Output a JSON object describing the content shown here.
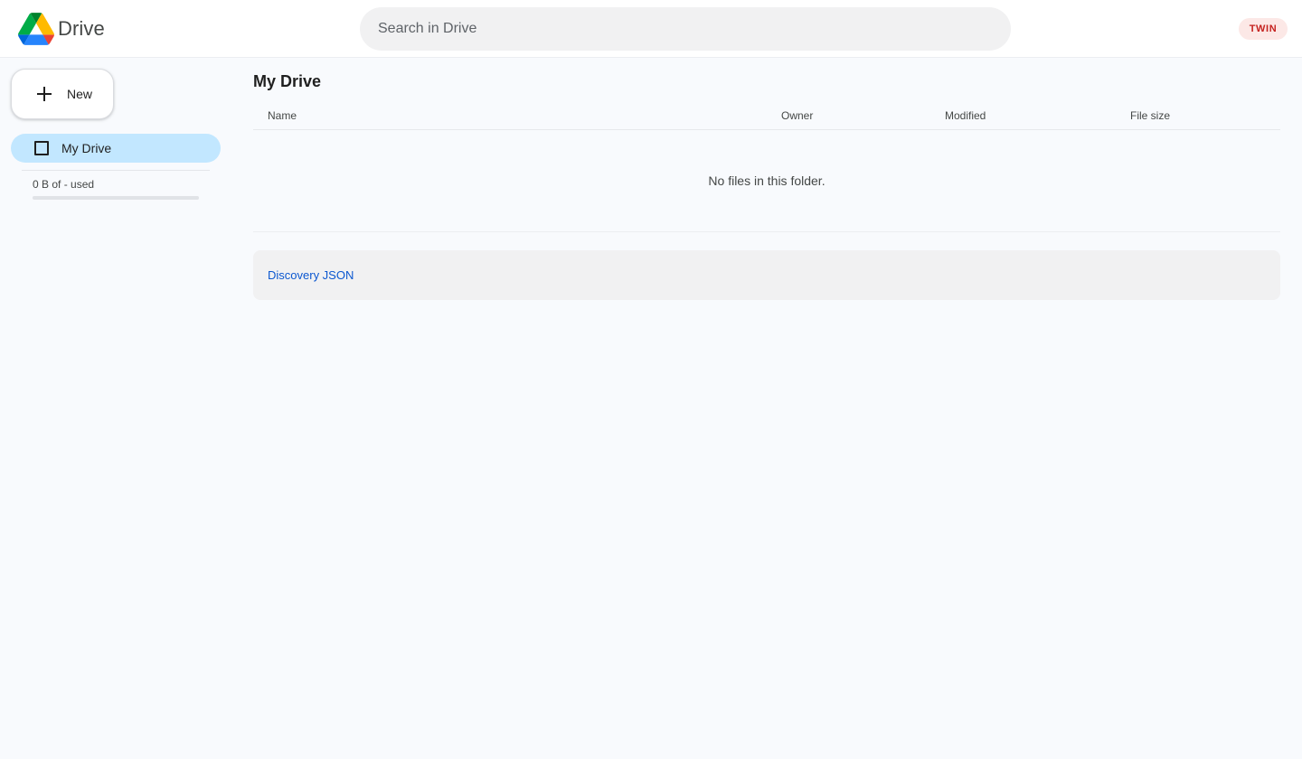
{
  "header": {
    "app_name": "Drive",
    "logo_icon": "google-drive-logo-icon",
    "search": {
      "placeholder": "Search in Drive",
      "value": ""
    },
    "badge": "TWIN",
    "colors": {
      "badge_bg": "#fce8e6",
      "badge_text": "#c5221f"
    }
  },
  "sidebar": {
    "new_button": {
      "label": "New",
      "icon": "plus-icon"
    },
    "items": [
      {
        "label": "My Drive",
        "icon": "square-icon",
        "selected": true
      }
    ],
    "storage": {
      "text": "0 B of - used",
      "used_fraction": 0
    },
    "colors": {
      "selected_bg": "#c2e7ff"
    }
  },
  "main": {
    "title": "My Drive",
    "columns": [
      "Name",
      "Owner",
      "Modified",
      "File size"
    ],
    "rows": [],
    "empty_message": "No files in this folder.",
    "footer_link": "Discovery JSON"
  },
  "theme": {
    "background": "#f8fafd",
    "link": "#0b57d0",
    "text": "#1f1f1f"
  }
}
